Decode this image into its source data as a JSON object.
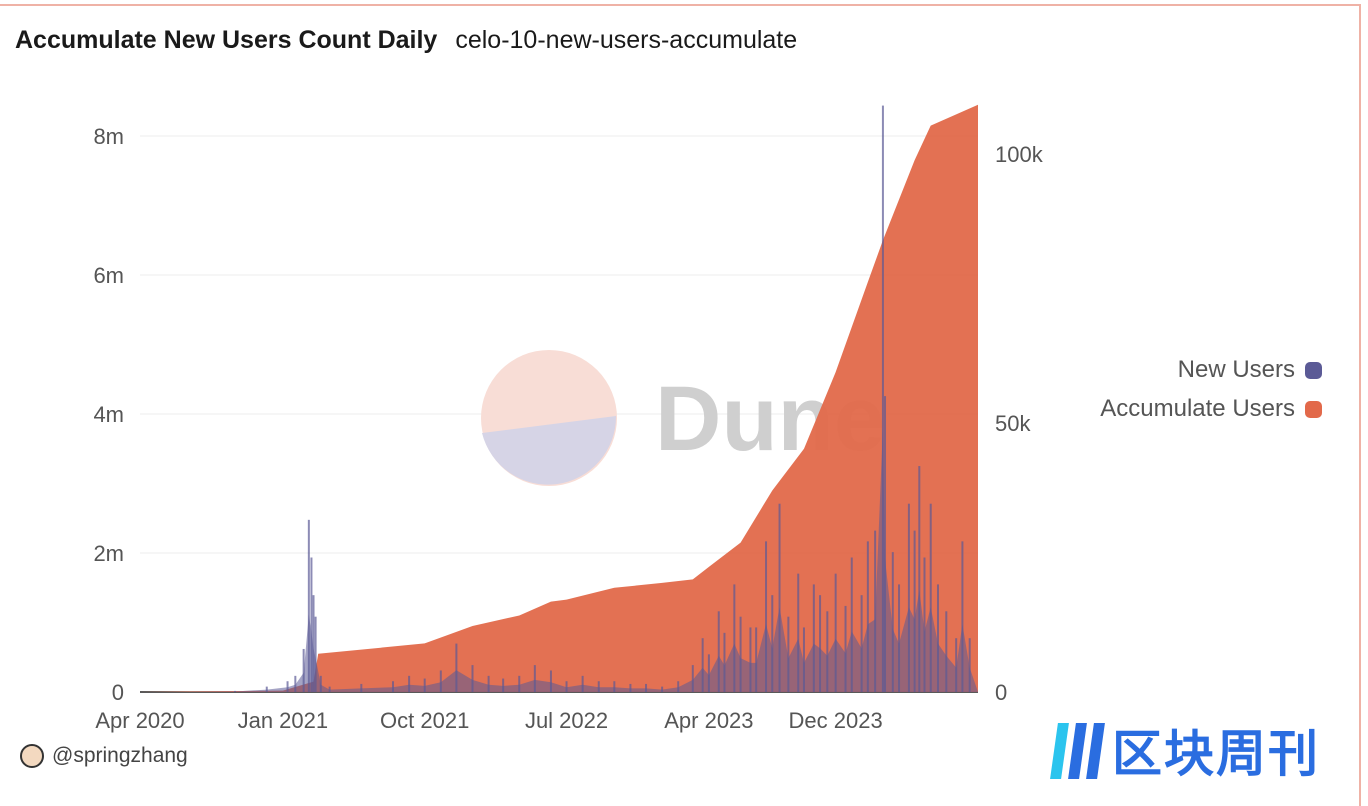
{
  "header": {
    "title": "Accumulate New Users Count Daily",
    "subtitle": "celo-10-new-users-accumulate"
  },
  "footer": {
    "author": "@springzhang"
  },
  "watermark": {
    "dune_text": "Dune",
    "logo_text": "区块周刊"
  },
  "colors": {
    "new_users": "#5b5a96",
    "accumulate_users": "#e2694a",
    "border": "#efb2a6"
  },
  "chart_data": {
    "type": "area",
    "title": "Accumulate New Users Count Daily",
    "x_ticks": [
      "Apr 2020",
      "Jan 2021",
      "Oct 2021",
      "Jul 2022",
      "Apr 2023",
      "Dec 2023"
    ],
    "x_tick_dates": [
      "2020-04-01",
      "2021-01-01",
      "2021-10-01",
      "2022-07-01",
      "2023-04-01",
      "2023-12-01"
    ],
    "xlim": [
      "2020-04-01",
      "2024-08-31"
    ],
    "y_left": {
      "ticks": [
        "0",
        "2m",
        "4m",
        "6m",
        "8m"
      ],
      "tick_values": [
        0,
        2000000,
        4000000,
        6000000,
        8000000
      ],
      "lim": [
        0,
        8500000
      ]
    },
    "y_right": {
      "ticks": [
        "0",
        "50k",
        "100k"
      ],
      "tick_values": [
        0,
        50000,
        100000
      ],
      "lim": [
        0,
        110000
      ]
    },
    "grid": true,
    "legend_position": "right",
    "series": [
      {
        "name": "New Users",
        "axis": "right",
        "type": "bar",
        "color": "#5b5a96",
        "points": [
          [
            "2020-04-15",
            0
          ],
          [
            "2020-07-01",
            0
          ],
          [
            "2020-10-01",
            200
          ],
          [
            "2020-12-01",
            1000
          ],
          [
            "2021-01-10",
            2000
          ],
          [
            "2021-01-25",
            3000
          ],
          [
            "2021-02-10",
            8000
          ],
          [
            "2021-02-20",
            32000
          ],
          [
            "2021-02-25",
            25000
          ],
          [
            "2021-03-01",
            18000
          ],
          [
            "2021-03-05",
            14000
          ],
          [
            "2021-03-15",
            3000
          ],
          [
            "2021-04-01",
            1000
          ],
          [
            "2021-06-01",
            1500
          ],
          [
            "2021-08-01",
            2000
          ],
          [
            "2021-09-01",
            3000
          ],
          [
            "2021-10-01",
            2500
          ],
          [
            "2021-11-01",
            4000
          ],
          [
            "2021-12-01",
            9000
          ],
          [
            "2022-01-01",
            5000
          ],
          [
            "2022-02-01",
            3000
          ],
          [
            "2022-03-01",
            2500
          ],
          [
            "2022-04-01",
            3000
          ],
          [
            "2022-05-01",
            5000
          ],
          [
            "2022-06-01",
            4000
          ],
          [
            "2022-07-01",
            2000
          ],
          [
            "2022-08-01",
            3000
          ],
          [
            "2022-09-01",
            2000
          ],
          [
            "2022-10-01",
            2000
          ],
          [
            "2022-11-01",
            1500
          ],
          [
            "2022-12-01",
            1500
          ],
          [
            "2023-01-01",
            1000
          ],
          [
            "2023-02-01",
            2000
          ],
          [
            "2023-03-01",
            5000
          ],
          [
            "2023-03-20",
            10000
          ],
          [
            "2023-04-01",
            7000
          ],
          [
            "2023-04-20",
            15000
          ],
          [
            "2023-05-01",
            11000
          ],
          [
            "2023-05-20",
            20000
          ],
          [
            "2023-06-01",
            14000
          ],
          [
            "2023-06-20",
            12000
          ],
          [
            "2023-07-01",
            12000
          ],
          [
            "2023-07-20",
            28000
          ],
          [
            "2023-08-01",
            18000
          ],
          [
            "2023-08-15",
            35000
          ],
          [
            "2023-09-01",
            14000
          ],
          [
            "2023-09-20",
            22000
          ],
          [
            "2023-10-01",
            12000
          ],
          [
            "2023-10-20",
            20000
          ],
          [
            "2023-11-01",
            18000
          ],
          [
            "2023-11-15",
            15000
          ],
          [
            "2023-12-01",
            22000
          ],
          [
            "2023-12-20",
            16000
          ],
          [
            "2024-01-01",
            25000
          ],
          [
            "2024-01-20",
            18000
          ],
          [
            "2024-02-01",
            28000
          ],
          [
            "2024-02-15",
            30000
          ],
          [
            "2024-03-01",
            109000
          ],
          [
            "2024-03-05",
            55000
          ],
          [
            "2024-03-20",
            26000
          ],
          [
            "2024-04-01",
            20000
          ],
          [
            "2024-04-20",
            35000
          ],
          [
            "2024-05-01",
            30000
          ],
          [
            "2024-05-10",
            42000
          ],
          [
            "2024-05-20",
            25000
          ],
          [
            "2024-06-01",
            35000
          ],
          [
            "2024-06-15",
            20000
          ],
          [
            "2024-07-01",
            15000
          ],
          [
            "2024-07-20",
            10000
          ],
          [
            "2024-08-01",
            28000
          ],
          [
            "2024-08-15",
            10000
          ]
        ]
      },
      {
        "name": "Accumulate Users",
        "axis": "left",
        "type": "area",
        "color": "#e2694a",
        "points": [
          [
            "2020-04-01",
            0
          ],
          [
            "2021-01-01",
            20000
          ],
          [
            "2021-03-01",
            150000
          ],
          [
            "2021-03-10",
            550000
          ],
          [
            "2021-10-01",
            700000
          ],
          [
            "2022-01-01",
            950000
          ],
          [
            "2022-04-01",
            1100000
          ],
          [
            "2022-06-01",
            1300000
          ],
          [
            "2022-07-01",
            1330000
          ],
          [
            "2022-10-01",
            1500000
          ],
          [
            "2023-01-01",
            1570000
          ],
          [
            "2023-03-01",
            1620000
          ],
          [
            "2023-04-01",
            1800000
          ],
          [
            "2023-06-01",
            2150000
          ],
          [
            "2023-08-01",
            2900000
          ],
          [
            "2023-10-01",
            3500000
          ],
          [
            "2023-12-01",
            4600000
          ],
          [
            "2024-02-01",
            5900000
          ],
          [
            "2024-03-01",
            6500000
          ],
          [
            "2024-05-01",
            7650000
          ],
          [
            "2024-06-01",
            8150000
          ],
          [
            "2024-08-31",
            8450000
          ]
        ]
      }
    ]
  }
}
